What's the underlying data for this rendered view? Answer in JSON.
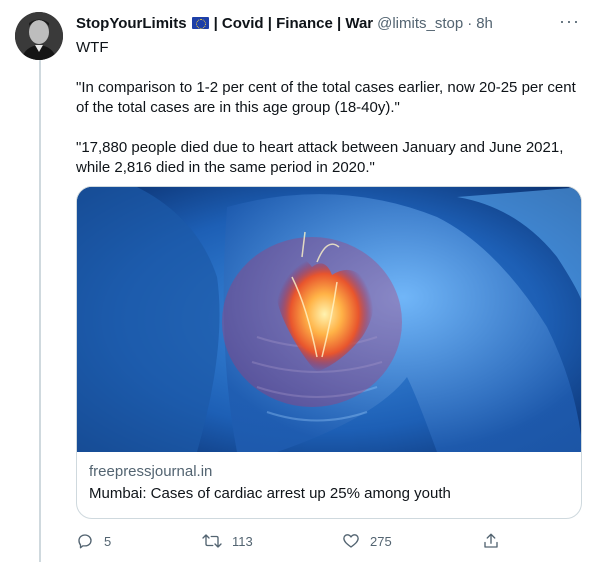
{
  "tweet": {
    "author_name": "StopYourLimits",
    "author_suffix": "| Covid | Finance | War",
    "handle": "@limits_stop",
    "separator": "·",
    "time": "8h",
    "more_icon": "more-horizontal-icon",
    "flag_icon": "eu-flag-icon",
    "body": [
      "WTF",
      "\"In comparison to 1-2 per cent of the total cases earlier, now 20-25 per cent of the total cases are in this age group (18-40y).\"",
      "\"17,880 people died due to heart attack between January and June 2021, while 2,816 died in the same period in 2020.\""
    ]
  },
  "card": {
    "domain": "freepressjournal.in",
    "title": "Mumbai: Cases of cardiac arrest up 25% among youth"
  },
  "actions": {
    "reply_count": "5",
    "retweet_count": "113",
    "like_count": "275"
  },
  "colors": {
    "text": "#0f1419",
    "secondary": "#536471",
    "border": "#cfd9de"
  }
}
